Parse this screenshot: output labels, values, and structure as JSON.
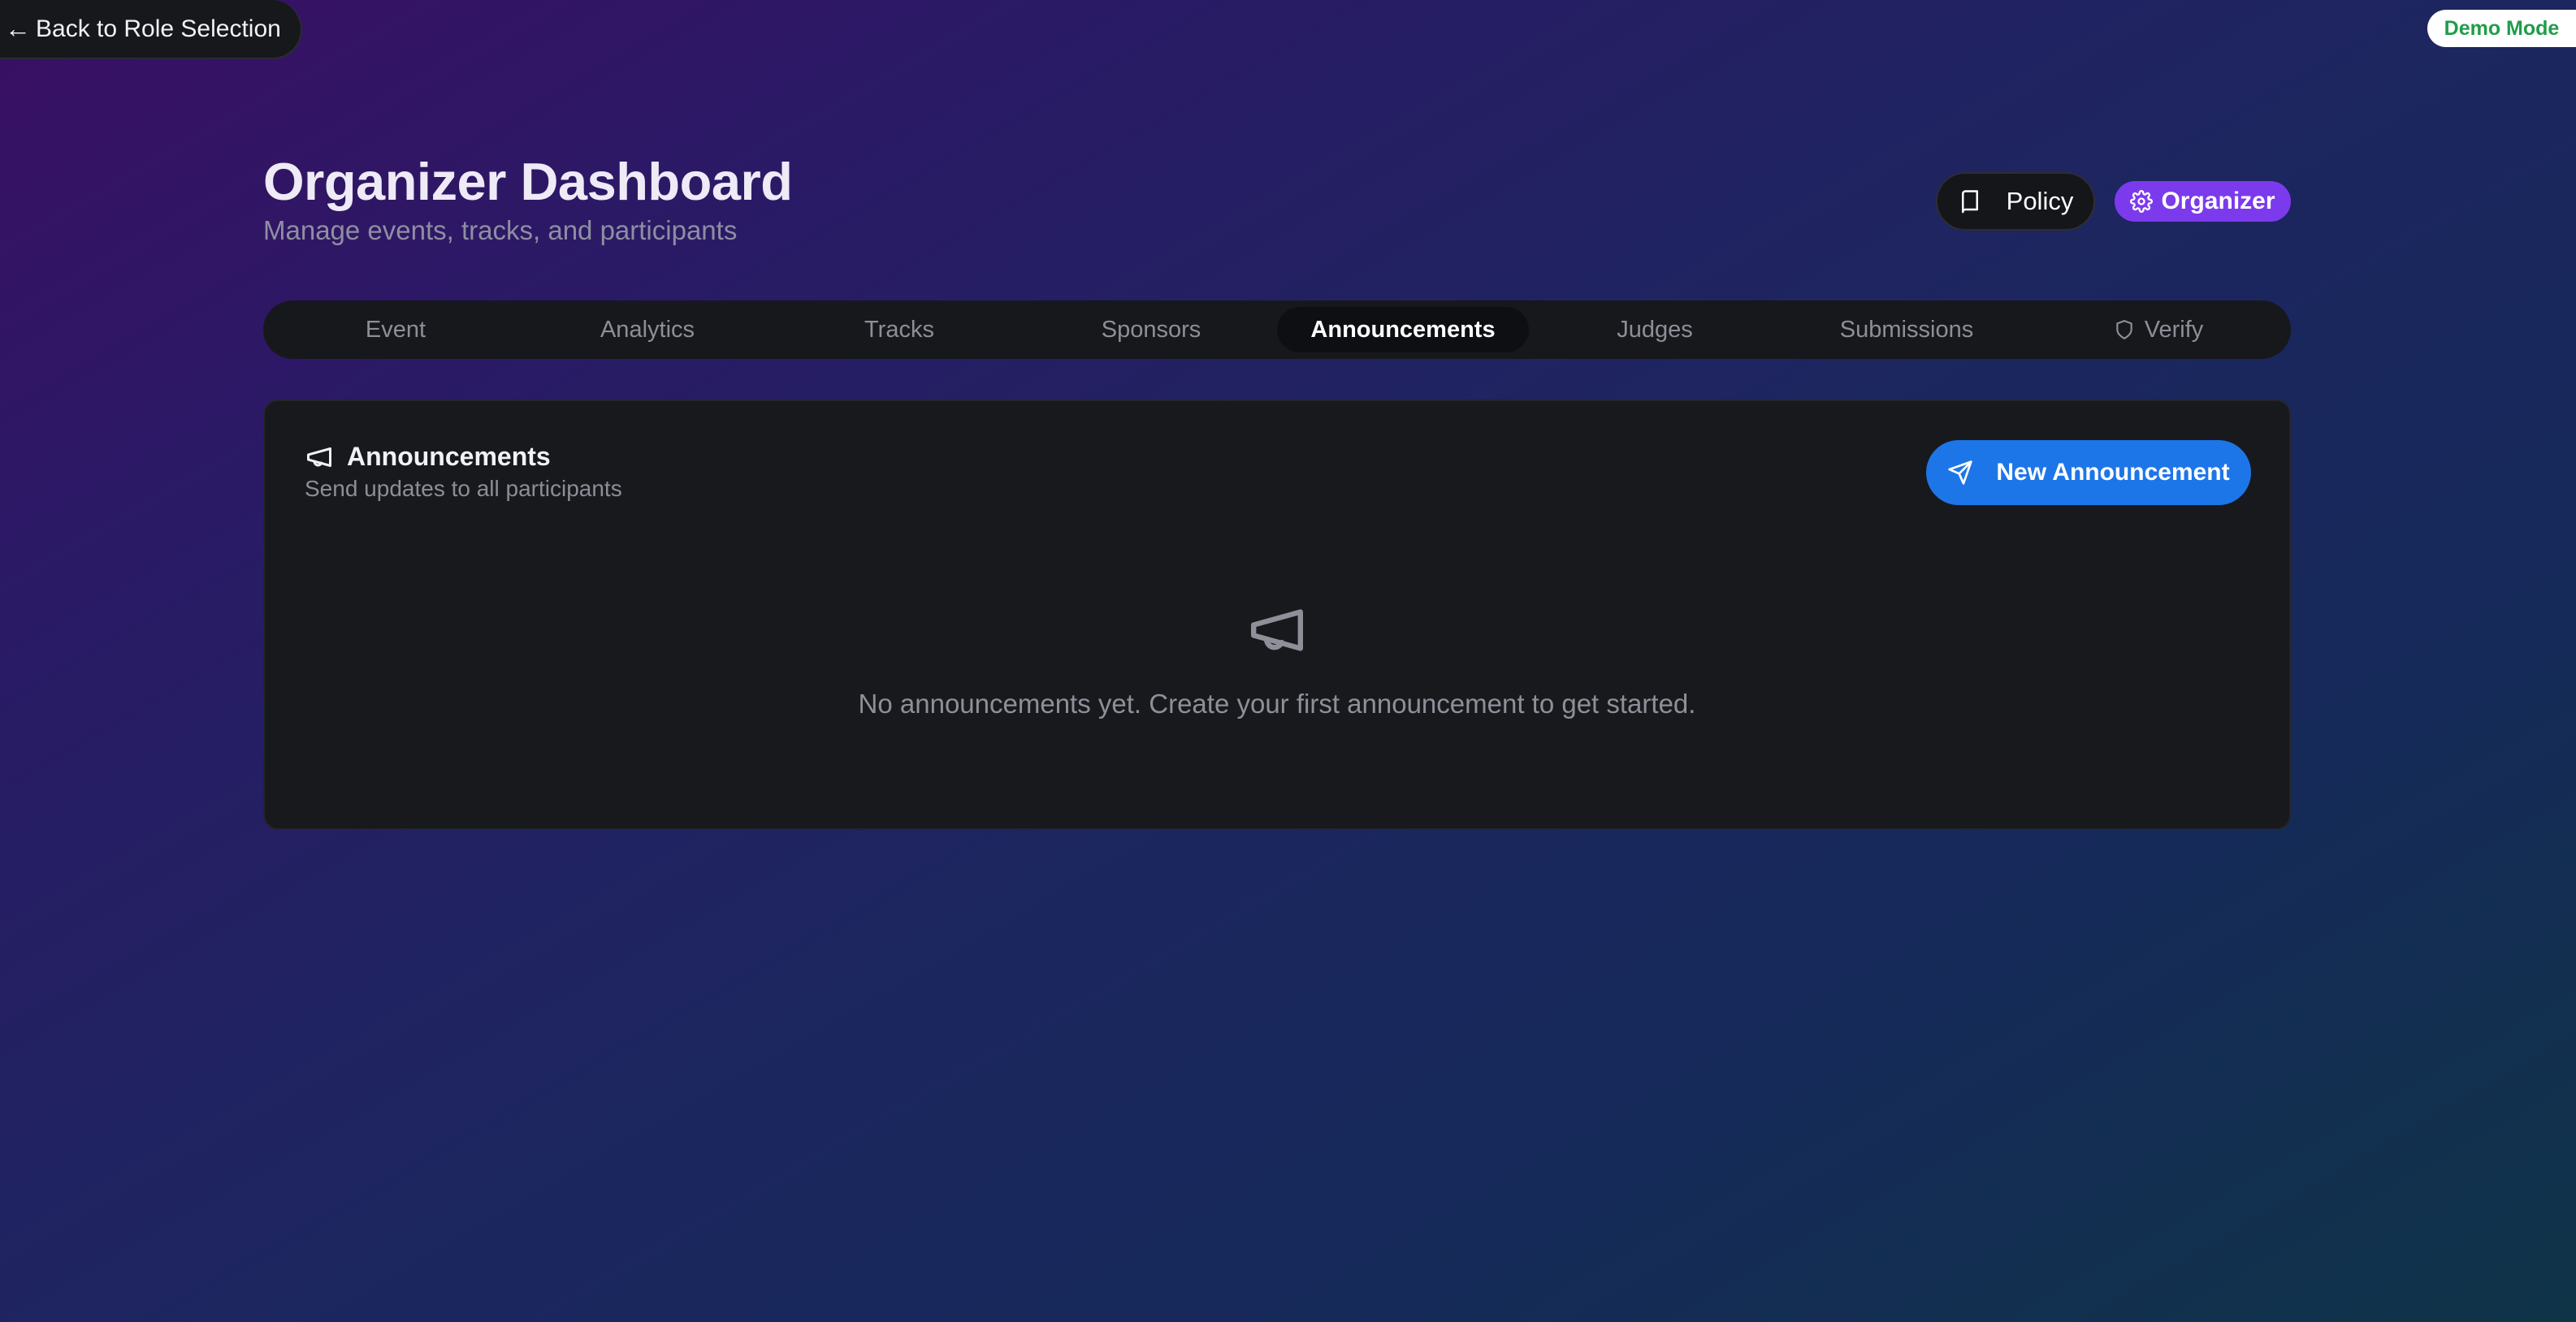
{
  "back_button": {
    "arrow": "←",
    "label": "Back to Role Selection"
  },
  "demo_badge": "Demo Mode",
  "header": {
    "title": "Organizer Dashboard",
    "subtitle": "Manage events, tracks, and participants",
    "policy_label": "Policy",
    "role_label": "Organizer"
  },
  "tabs": [
    {
      "label": "Event"
    },
    {
      "label": "Analytics"
    },
    {
      "label": "Tracks"
    },
    {
      "label": "Sponsors"
    },
    {
      "label": "Announcements",
      "active": true
    },
    {
      "label": "Judges"
    },
    {
      "label": "Submissions"
    },
    {
      "label": "Verify",
      "icon": "shield-icon"
    }
  ],
  "announcements": {
    "title": "Announcements",
    "subtitle": "Send updates to all participants",
    "new_button": "New Announcement",
    "empty_text": "No announcements yet. Create your first announcement to get started."
  },
  "colors": {
    "accent_blue": "#1d76e8",
    "role_purple": "#7c3aed",
    "demo_green": "#1f9d4a"
  }
}
